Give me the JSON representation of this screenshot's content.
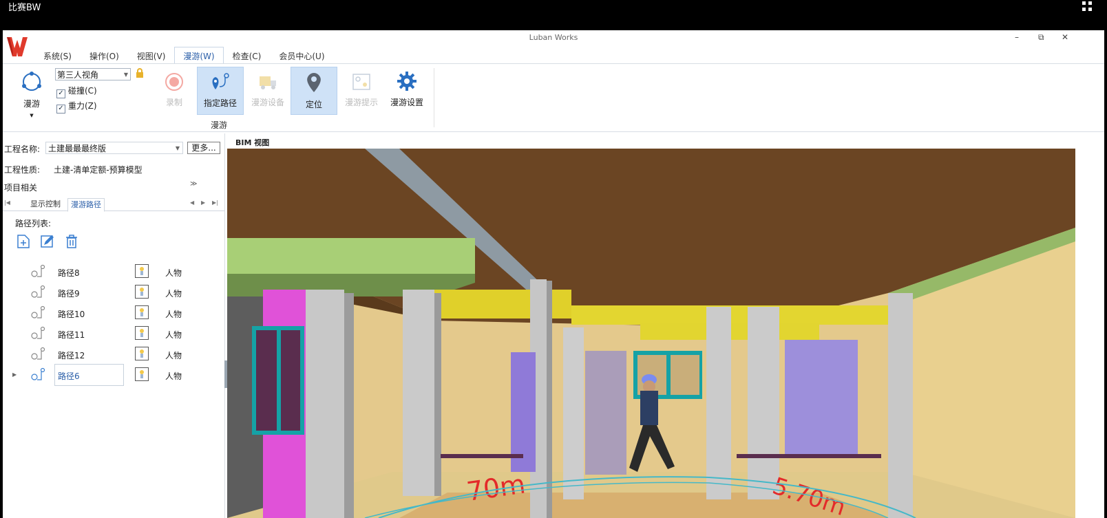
{
  "os_bar": {
    "title": "比赛BW",
    "exit_icon": "exit-fullscreen-icon"
  },
  "window": {
    "title": "Luban Works",
    "minimize": "–",
    "restore": "⧉",
    "close": "✕"
  },
  "menu": [
    "系统(S)",
    "操作(O)",
    "视图(V)",
    "漫游(W)",
    "检查(C)",
    "会员中心(U)"
  ],
  "ribbon": {
    "roam_label": "漫游",
    "view_mode": "第三人视角",
    "collision": "碰撞(C)",
    "gravity": "重力(Z)",
    "record_label": "录制",
    "specify_path": "指定路径",
    "roam_device": "漫游设备",
    "locate": "定位",
    "roam_prompt": "漫游提示",
    "roam_settings": "漫游设置",
    "group_label": "漫游"
  },
  "left_panel": {
    "project_name_label": "工程名称:",
    "project_name": "土建最最最终版",
    "more_button": "更多...",
    "project_type_label": "工程性质:",
    "project_type": "土建-清单定额-预算模型",
    "project_related": "项目相关",
    "tabs": [
      "显示控制",
      "漫游路径"
    ],
    "path_list_label": "路径列表:",
    "paths": [
      {
        "name": "路径8",
        "type": "人物"
      },
      {
        "name": "路径9",
        "type": "人物"
      },
      {
        "name": "路径10",
        "type": "人物"
      },
      {
        "name": "路径11",
        "type": "人物"
      },
      {
        "name": "路径12",
        "type": "人物"
      },
      {
        "name": "路径6",
        "type": "人物"
      }
    ]
  },
  "view": {
    "title": "BIM 视图",
    "floor_text_left": "70m",
    "floor_text_right": "5.70m"
  },
  "colors": {
    "accent": "#2a5ea8",
    "selected_button": "#cfe2f7",
    "ceiling": "#6b4523",
    "wall": "#e6c98a"
  }
}
